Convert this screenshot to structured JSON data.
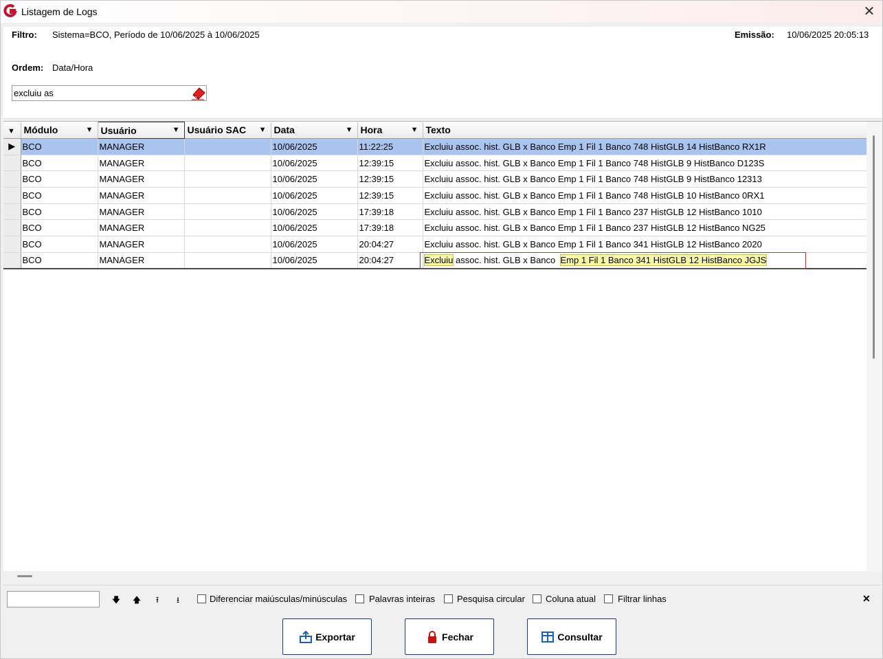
{
  "window": {
    "title": "Listagem de Logs"
  },
  "header": {
    "filter_label": "Filtro:",
    "filter_value": "Sistema=BCO, Período de 10/06/2025 à 10/06/2025",
    "emission_label": "Emissão:",
    "emission_value": "10/06/2025 20:05:13",
    "order_label": "Ordem:",
    "order_value": "Data/Hora",
    "search_value": "excluiu as"
  },
  "grid": {
    "columns": [
      "Módulo",
      "Usuário",
      "Usuário SAC",
      "Data",
      "Hora",
      "Texto"
    ],
    "rows": [
      {
        "modulo": "BCO",
        "usuario": "MANAGER",
        "usuario_sac": "",
        "data": "10/06/2025",
        "hora": "11:22:25",
        "texto": "Excluiu assoc. hist. GLB x Banco  Emp 1 Fil 1 Banco 748 HistGLB 14 HistBanco RX1R"
      },
      {
        "modulo": "BCO",
        "usuario": "MANAGER",
        "usuario_sac": "",
        "data": "10/06/2025",
        "hora": "12:39:15",
        "texto": "Excluiu assoc. hist. GLB x Banco  Emp 1 Fil 1 Banco 748 HistGLB 9 HistBanco D123S"
      },
      {
        "modulo": "BCO",
        "usuario": "MANAGER",
        "usuario_sac": "",
        "data": "10/06/2025",
        "hora": "12:39:15",
        "texto": "Excluiu assoc. hist. GLB x Banco  Emp 1 Fil 1 Banco 748 HistGLB 9 HistBanco 12313"
      },
      {
        "modulo": "BCO",
        "usuario": "MANAGER",
        "usuario_sac": "",
        "data": "10/06/2025",
        "hora": "12:39:15",
        "texto": "Excluiu assoc. hist. GLB x Banco  Emp 1 Fil 1 Banco 748 HistGLB 10 HistBanco 0RX1"
      },
      {
        "modulo": "BCO",
        "usuario": "MANAGER",
        "usuario_sac": "",
        "data": "10/06/2025",
        "hora": "17:39:18",
        "texto": "Excluiu assoc. hist. GLB x Banco  Emp 1 Fil 1 Banco 237 HistGLB 12 HistBanco 1010"
      },
      {
        "modulo": "BCO",
        "usuario": "MANAGER",
        "usuario_sac": "",
        "data": "10/06/2025",
        "hora": "17:39:18",
        "texto": "Excluiu assoc. hist. GLB x Banco  Emp 1 Fil 1 Banco 237 HistGLB 12 HistBanco NG25"
      },
      {
        "modulo": "BCO",
        "usuario": "MANAGER",
        "usuario_sac": "",
        "data": "10/06/2025",
        "hora": "20:04:27",
        "texto": "Excluiu assoc. hist. GLB x Banco  Emp 1 Fil 1 Banco 341 HistGLB 12 HistBanco 2020"
      },
      {
        "modulo": "BCO",
        "usuario": "MANAGER",
        "usuario_sac": "",
        "data": "10/06/2025",
        "hora": "20:04:27",
        "texto_parts": [
          "Excluiu",
          " assoc. hist. GLB x Banco  ",
          "Emp 1 Fil 1 Banco 341 HistGLB 12 HistBanco JGJS"
        ]
      }
    ]
  },
  "findbar": {
    "options": [
      "Diferenciar maiúsculas/minúsculas",
      "Palavras inteiras",
      "Pesquisa circular",
      "Coluna atual",
      "Filtrar linhas"
    ]
  },
  "buttons": {
    "export": "Exportar",
    "close": "Fechar",
    "query": "Consultar"
  },
  "colors": {
    "selected_row": "#aac4f0",
    "highlight": "#fafaa0",
    "red_mark": "#d03030",
    "brand": "#c8102e"
  },
  "icons": [
    "app-logo-icon",
    "close-icon",
    "eraser-icon",
    "filter-icon",
    "row-pointer-icon",
    "arrow-down-icon",
    "arrow-up-icon",
    "arrow-first-icon",
    "arrow-last-icon",
    "export-icon",
    "lock-icon",
    "grid-icon"
  ]
}
